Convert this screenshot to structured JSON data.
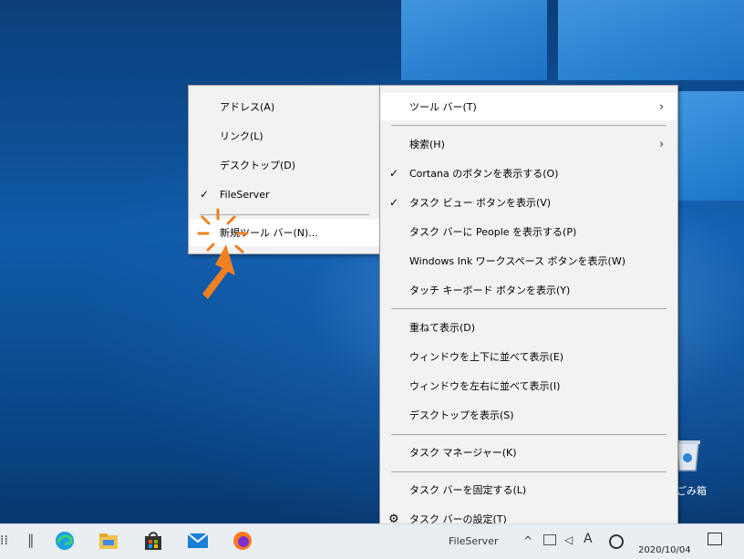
{
  "submenu": {
    "items": [
      {
        "label": "アドレス(A)",
        "checked": false
      },
      {
        "label": "リンク(L)",
        "checked": false
      },
      {
        "label": "デスクトップ(D)",
        "checked": false
      },
      {
        "label": "FileServer",
        "checked": true
      }
    ],
    "new_toolbar_label": "新規ツール バー(N)..."
  },
  "context_menu": {
    "toolbar_label": "ツール バー(T)",
    "search_label": "検索(H)",
    "cortana_label": "Cortana のボタンを表示する(O)",
    "taskview_label": "タスク ビュー ボタンを表示(V)",
    "people_label": "タスク バーに People を表示する(P)",
    "ink_label": "Windows Ink ワークスペース ボタンを表示(W)",
    "touch_keyboard_label": "タッチ キーボード ボタンを表示(Y)",
    "cascade_label": "重ねて表示(D)",
    "stack_label": "ウィンドウを上下に並べて表示(E)",
    "side_by_side_label": "ウィンドウを左右に並べて表示(I)",
    "show_desktop_label": "デスクトップを表示(S)",
    "task_manager_label": "タスク マネージャー(K)",
    "lock_taskbar_label": "タスク バーを固定する(L)",
    "taskbar_settings_label": "タスク バーの設定(T)"
  },
  "desktop": {
    "recycle_bin_label": "ごみ箱"
  },
  "taskbar": {
    "toolbar_label": "FileServer",
    "date": "2020/10/04",
    "ime_indicator": "A",
    "pinned_apps": [
      "edge-icon",
      "file-explorer-icon",
      "store-icon",
      "mail-icon",
      "firefox-icon"
    ]
  },
  "colors": {
    "accent_arrow": "#f08020",
    "menu_bg": "#f2f2f2",
    "taskbar_bg": "#e9eef3"
  }
}
